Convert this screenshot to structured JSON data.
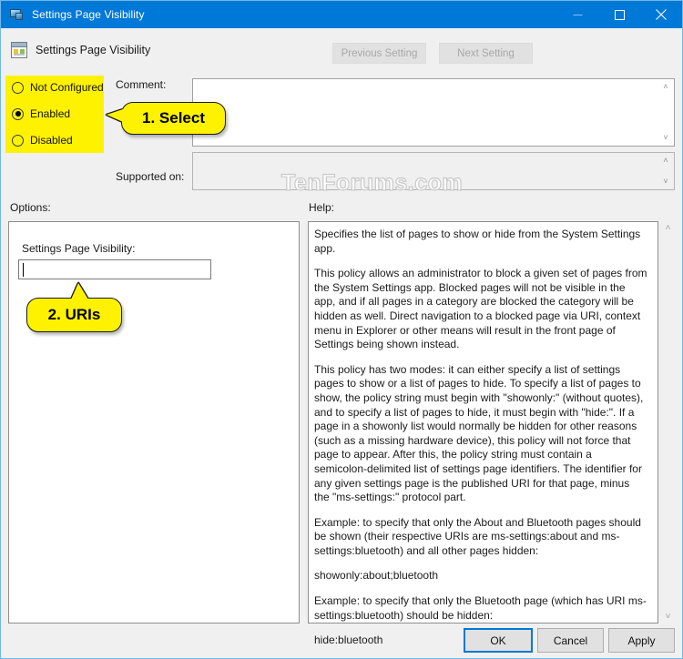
{
  "window": {
    "title": "Settings Page Visibility",
    "icon": "settings-monitor-icon",
    "minimize_label": "Minimize",
    "maximize_label": "Maximize",
    "close_label": "Close"
  },
  "header": {
    "title": "Settings Page Visibility",
    "icon": "policy-setting-icon",
    "previous_setting": "Previous Setting",
    "next_setting": "Next Setting"
  },
  "state": {
    "options": [
      {
        "label": "Not Configured",
        "selected": false
      },
      {
        "label": "Enabled",
        "selected": true
      },
      {
        "label": "Disabled",
        "selected": false
      }
    ]
  },
  "fields": {
    "comment_label": "Comment:",
    "comment_value": "",
    "supported_label": "Supported on:",
    "supported_value": ""
  },
  "sections": {
    "options_label": "Options:",
    "help_label": "Help:"
  },
  "options_panel": {
    "setting_label": "Settings Page Visibility:",
    "setting_value": ""
  },
  "help": {
    "paragraphs": [
      "Specifies the list of pages to show or hide from the System Settings app.",
      "This policy allows an administrator to block a given set of pages from the System Settings app. Blocked pages will not be visible in the app, and if all pages in a category are blocked the category will be hidden as well. Direct navigation to a blocked page via URI, context menu in Explorer or other means will result in the front page of Settings being shown instead.",
      "This policy has two modes: it can either specify a list of settings pages to show or a list of pages to hide. To specify a list of pages to show, the policy string must begin with \"showonly:\" (without quotes), and to specify a list of pages to hide, it must begin with \"hide:\". If a page in a showonly list would normally be hidden for other reasons (such as a missing hardware device), this policy will not force that page to appear. After this, the policy string must contain a semicolon-delimited list of settings page identifiers. The identifier for any given settings page is the published URI for that page, minus the \"ms-settings:\" protocol part.",
      "Example: to specify that only the About and Bluetooth pages should be shown (their respective URIs are ms-settings:about and ms-settings:bluetooth) and all other pages hidden:",
      "showonly:about;bluetooth",
      "Example: to specify that only the Bluetooth page (which has URI ms-settings:bluetooth) should be hidden:",
      "hide:bluetooth"
    ]
  },
  "callouts": {
    "step1": "1. Select",
    "step2": "2. URIs"
  },
  "watermark": "TenForums.com",
  "footer": {
    "ok": "OK",
    "cancel": "Cancel",
    "apply": "Apply"
  },
  "colors": {
    "titlebar": "#0078d7",
    "highlight": "#fff200",
    "accent": "#0078d7",
    "window_bg": "#f0f0f0"
  },
  "scroll_icons": {
    "up": "˄",
    "down": "˅"
  }
}
